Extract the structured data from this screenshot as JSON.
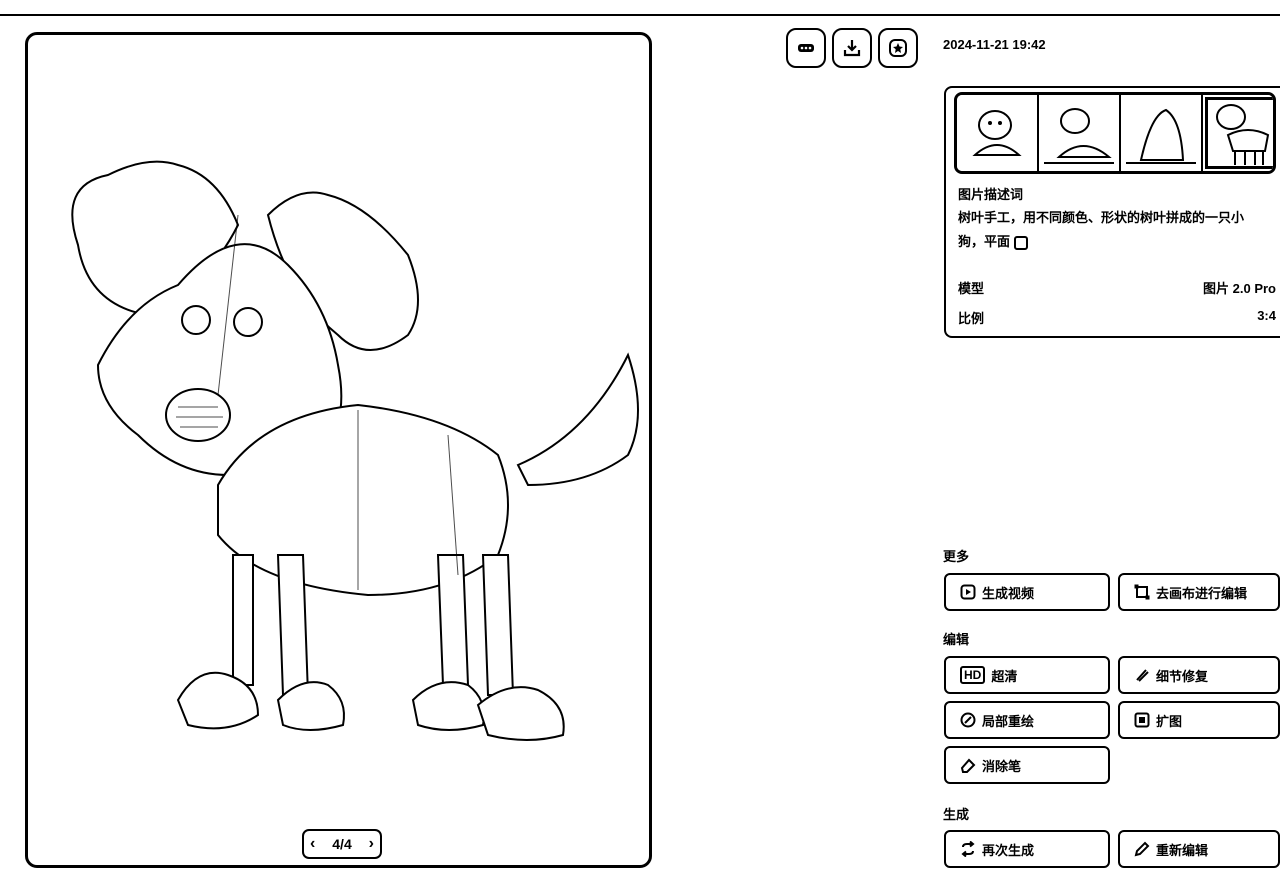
{
  "toolbar": {
    "more_icon": "ellipsis-icon",
    "download_icon": "download-icon",
    "favorite_icon": "star-icon"
  },
  "viewer": {
    "pager_text": "4/4",
    "prev_icon": "chevron-left-icon",
    "next_icon": "chevron-right-icon"
  },
  "meta": {
    "datetime": "2024-11-21 19:42",
    "prompt_title": "图片描述词",
    "prompt_text": "树叶手工，用不同颜色、形状的树叶拼成的一只小狗，平面",
    "model_label": "模型",
    "model_value": "图片 2.0 Pro",
    "ratio_label": "比例",
    "ratio_value": "3:4"
  },
  "sections": {
    "more": "更多",
    "edit": "编辑",
    "generate": "生成"
  },
  "actions": {
    "gen_video": "生成视频",
    "canvas_edit": "去画布进行编辑",
    "hd": "超清",
    "hd_badge": "HD",
    "detail_fix": "细节修复",
    "inpaint": "局部重绘",
    "expand": "扩图",
    "eraser": "消除笔",
    "regen": "再次生成",
    "reedit": "重新编辑"
  }
}
